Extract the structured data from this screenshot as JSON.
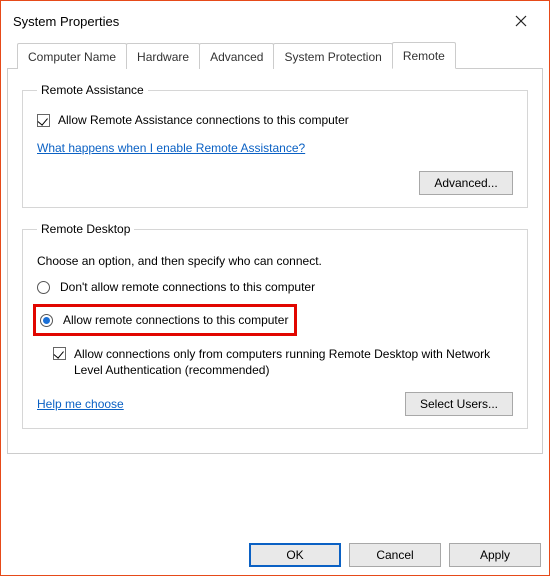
{
  "window": {
    "title": "System Properties"
  },
  "tabs": {
    "computerName": "Computer Name",
    "hardware": "Hardware",
    "advanced": "Advanced",
    "systemProtection": "System Protection",
    "remote": "Remote"
  },
  "remoteAssistance": {
    "legend": "Remote Assistance",
    "allowLabel": "Allow Remote Assistance connections to this computer",
    "helpLink": "What happens when I enable Remote Assistance?",
    "advancedBtn": "Advanced..."
  },
  "remoteDesktop": {
    "legend": "Remote Desktop",
    "instruction": "Choose an option, and then specify who can connect.",
    "optDisallow": "Don't allow remote connections to this computer",
    "optAllow": "Allow remote connections to this computer",
    "nla": "Allow connections only from computers running Remote Desktop with Network Level Authentication (recommended)",
    "helpLink": "Help me choose",
    "selectUsersBtn": "Select Users..."
  },
  "footer": {
    "ok": "OK",
    "cancel": "Cancel",
    "apply": "Apply"
  }
}
